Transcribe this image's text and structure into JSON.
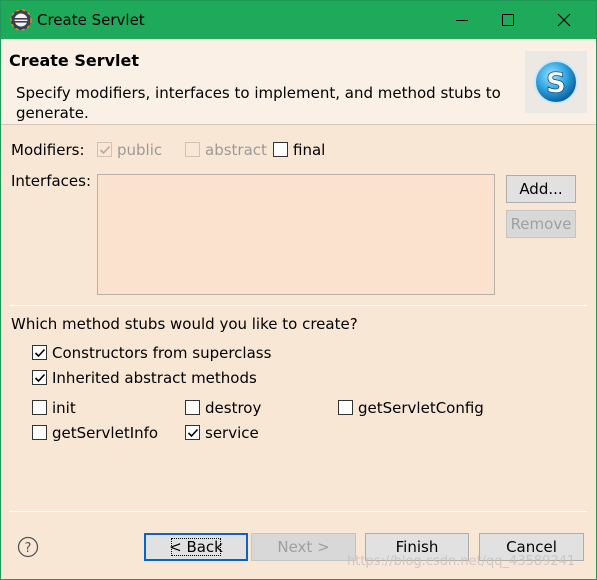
{
  "window": {
    "title": "Create Servlet",
    "icon": "eclipse-icon",
    "controls": [
      "minimize-icon",
      "maximize-icon",
      "close-icon"
    ]
  },
  "banner": {
    "heading": "Create Servlet",
    "description": "Specify modifiers, interfaces to implement, and method stubs to generate.",
    "logo": "servlet-s-logo",
    "logo_letter": "S"
  },
  "modifiers": {
    "label": "Modifiers:",
    "options": [
      {
        "label": "public",
        "checked": true,
        "enabled": false
      },
      {
        "label": "abstract",
        "checked": false,
        "enabled": false
      },
      {
        "label": "final",
        "checked": false,
        "enabled": true
      }
    ]
  },
  "interfaces": {
    "label": "Interfaces:",
    "items": [],
    "add_label": "Add...",
    "remove_label": "Remove"
  },
  "stubs": {
    "question": "Which method stubs would you like to create?",
    "primary": [
      {
        "label": "Constructors from superclass",
        "checked": true
      },
      {
        "label": "Inherited abstract methods",
        "checked": true
      }
    ],
    "methods": [
      {
        "label": "init",
        "checked": false
      },
      {
        "label": "destroy",
        "checked": false
      },
      {
        "label": "getServletConfig",
        "checked": false
      },
      {
        "label": "getServletInfo",
        "checked": false
      },
      {
        "label": "service",
        "checked": true
      }
    ]
  },
  "footer": {
    "help_icon": "help-icon",
    "help_glyph": "?",
    "back_label": "< Back",
    "next_label": "Next >",
    "finish_label": "Finish",
    "cancel_label": "Cancel"
  },
  "watermark": "https://blog.csdn.net/qq_43589241",
  "colors": {
    "titlebar": "#1ea95b",
    "dialog_bg": "#f9e7d6",
    "default_button_border": "#0a63c9"
  }
}
